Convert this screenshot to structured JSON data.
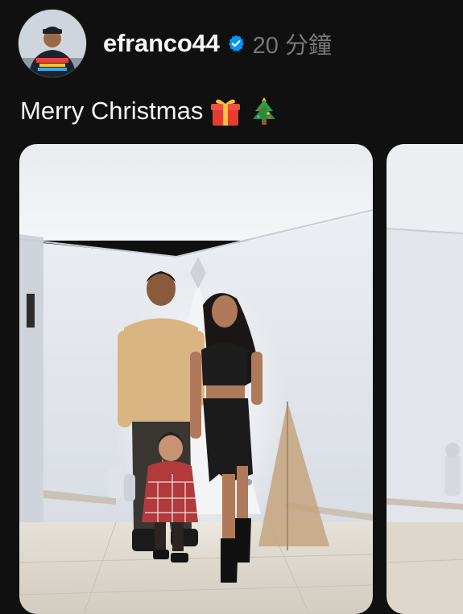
{
  "post": {
    "username": "efranco44",
    "verified": true,
    "timestamp": "20 分鐘",
    "caption_text": "Merry Christmas",
    "caption_emojis": [
      "gift-emoji",
      "christmas-tree-emoji"
    ]
  },
  "media": {
    "items": [
      {
        "kind": "photo",
        "icon": "family-christmas-photo"
      },
      {
        "kind": "photo",
        "icon": "next-carousel-photo"
      }
    ]
  },
  "colors": {
    "background": "#101010",
    "text_primary": "#f3f5f7",
    "text_secondary": "#777777",
    "verified_badge": "#0095f6"
  }
}
